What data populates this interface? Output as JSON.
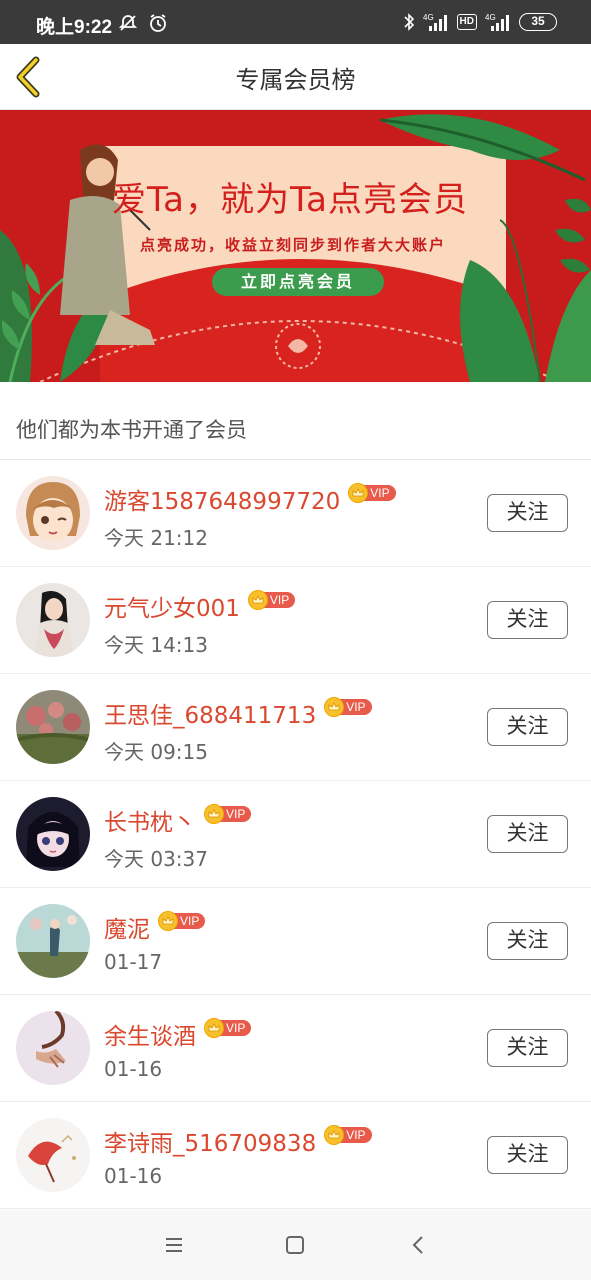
{
  "status_bar": {
    "time": "晚上9:22",
    "network_1": "4G",
    "hd": "HD",
    "network_2": "4G",
    "battery": "35"
  },
  "header": {
    "title": "专属会员榜"
  },
  "banner": {
    "headline": "爱Ta，就为Ta点亮会员",
    "subtitle": "点亮成功，收益立刻同步到作者大大账户",
    "button_label": "立即点亮会员"
  },
  "section": {
    "label": "他们都为本书开通了会员"
  },
  "members": [
    {
      "name": "游客1587648997720",
      "time": "今天 21:12",
      "vip": "VIP",
      "follow": "关注"
    },
    {
      "name": "元气少女001",
      "time": "今天 14:13",
      "vip": "VIP",
      "follow": "关注"
    },
    {
      "name": "王思佳_688411713",
      "time": "今天 09:15",
      "vip": "VIP",
      "follow": "关注"
    },
    {
      "name": "长书枕丶",
      "time": "今天 03:37",
      "vip": "VIP",
      "follow": "关注"
    },
    {
      "name": "魔泥",
      "time": "01-17",
      "vip": "VIP",
      "follow": "关注"
    },
    {
      "name": "余生谈酒",
      "time": "01-16",
      "vip": "VIP",
      "follow": "关注"
    },
    {
      "name": "李诗雨_516709838",
      "time": "01-16",
      "vip": "VIP",
      "follow": "关注"
    }
  ],
  "colors": {
    "name_color": "#d9482f",
    "banner_red": "#c81b1b",
    "button_green": "#3b9c4d",
    "back_arrow": "#e0b400"
  }
}
